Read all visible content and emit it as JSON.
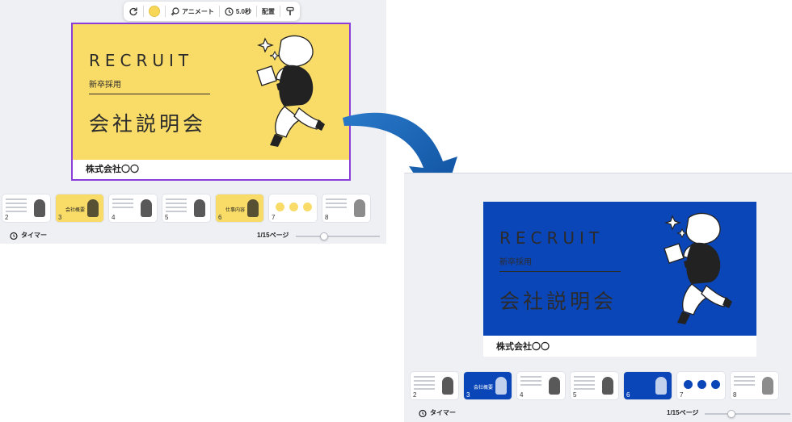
{
  "toolbar": {
    "animate_label": "アニメート",
    "duration_label": "5.0秒",
    "arrange_label": "配置",
    "selected_color": "#f8d757"
  },
  "before": {
    "slide": {
      "title": "RECRUIT",
      "subtitle": "新卒採用",
      "heading": "会社説明会",
      "company": "株式会社〇〇",
      "bg_color": "#f9dc68"
    },
    "thumbnails": [
      {
        "num": "2",
        "text": ""
      },
      {
        "num": "3",
        "text": "会社概要"
      },
      {
        "num": "4",
        "text": ""
      },
      {
        "num": "5",
        "text": ""
      },
      {
        "num": "6",
        "text": "仕事内容"
      },
      {
        "num": "7",
        "text": ""
      },
      {
        "num": "8",
        "text": ""
      }
    ],
    "status": {
      "timer_label": "タイマー",
      "page_indicator": "1/15ページ"
    }
  },
  "after": {
    "slide": {
      "title": "RECRUIT",
      "subtitle": "新卒採用",
      "heading": "会社説明会",
      "company": "株式会社〇〇",
      "bg_color": "#0b46b8"
    },
    "thumbnails": [
      {
        "num": "2",
        "text": ""
      },
      {
        "num": "3",
        "text": "会社概要"
      },
      {
        "num": "4",
        "text": ""
      },
      {
        "num": "5",
        "text": ""
      },
      {
        "num": "6",
        "text": ""
      },
      {
        "num": "7",
        "text": ""
      },
      {
        "num": "8",
        "text": ""
      }
    ],
    "status": {
      "timer_label": "タイマー",
      "page_indicator": "1/15ページ"
    }
  },
  "arrow_color": "#1a5fb4"
}
